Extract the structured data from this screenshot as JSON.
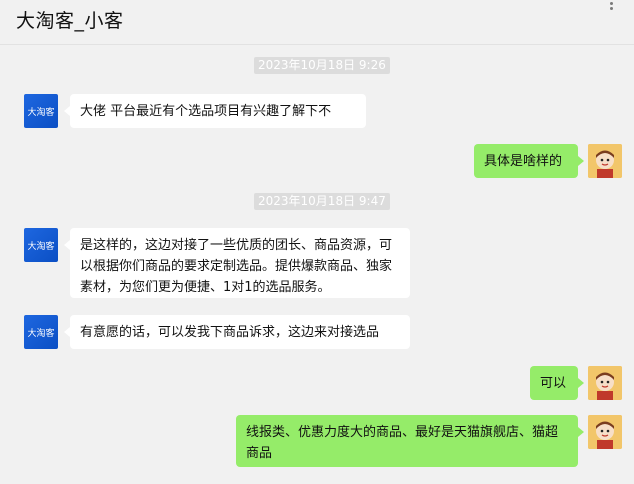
{
  "chat": {
    "title": "大淘客_小客",
    "brand_avatar_text": "大淘客",
    "timestamps": [
      "2023年10月18日 9:26",
      "2023年10月18日 9:47"
    ],
    "messages": [
      {
        "side": "left",
        "text": "大佬   平台最近有个选品项目有兴趣了解下不"
      },
      {
        "side": "right",
        "text": "具体是啥样的"
      },
      {
        "side": "left",
        "text": "是这样的，这边对接了一些优质的团长、商品资源，可以根据你们商品的要求定制选品。提供爆款商品、独家素材，为您们更为便捷、1对1的选品服务。"
      },
      {
        "side": "left",
        "text": "有意愿的话，可以发我下商品诉求，这边来对接选品"
      },
      {
        "side": "right",
        "text": "可以"
      },
      {
        "side": "right",
        "text": "线报类、优惠力度大的商品、最好是天猫旗舰店、猫超商品"
      }
    ]
  },
  "colors": {
    "own_bubble": "#95ec69",
    "other_bubble": "#ffffff",
    "brand_blue": "#1e67e0"
  },
  "icons": {
    "menu": "more-dots-icon",
    "own_avatar": "cartoon-person-avatar"
  }
}
